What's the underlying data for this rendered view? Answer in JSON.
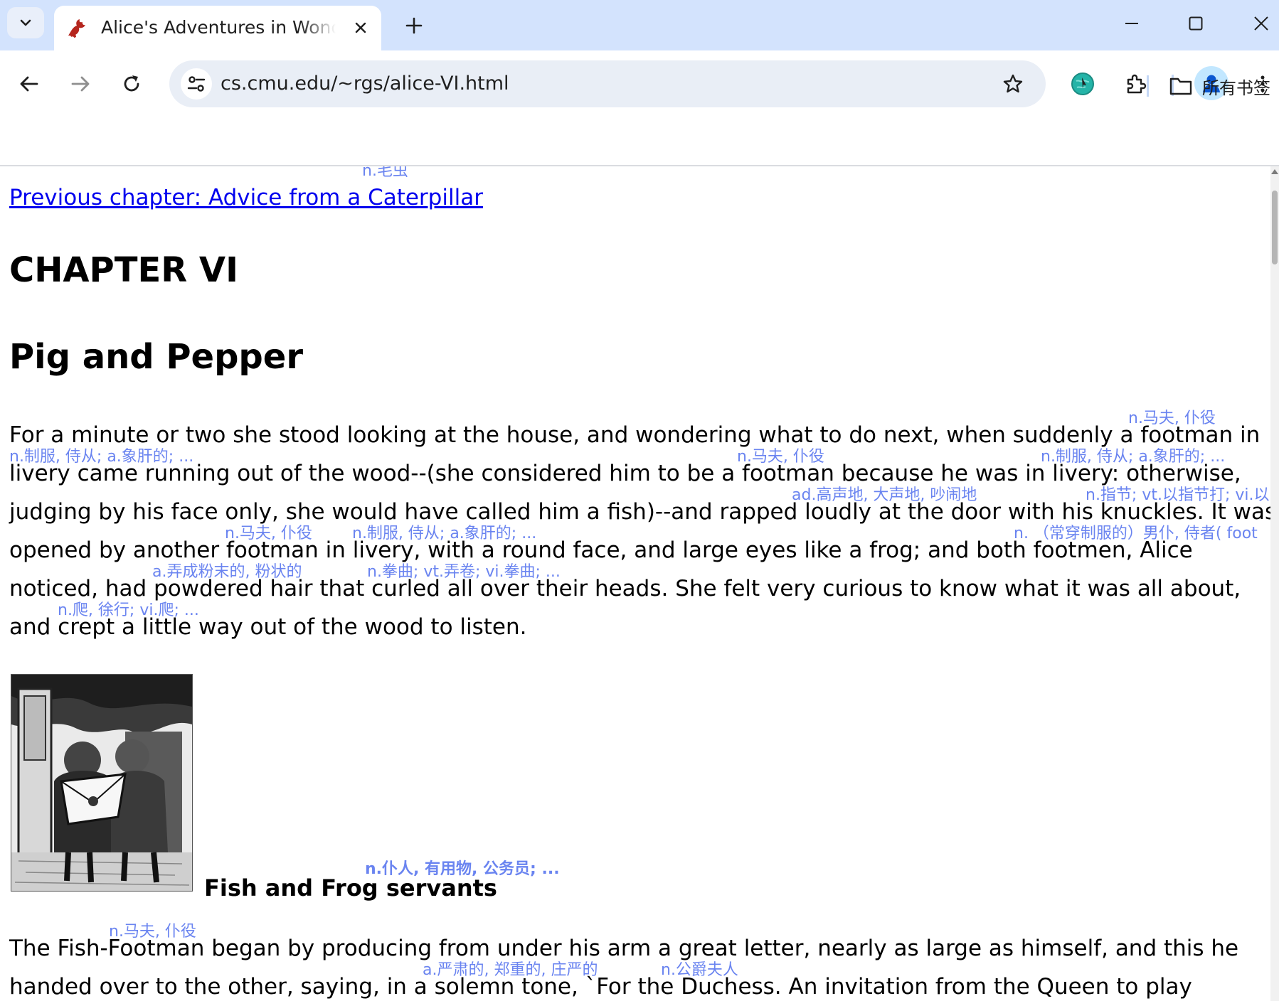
{
  "browser": {
    "tab_title": "Alice's Adventures in Wonderland",
    "url": "cs.cmu.edu/~rgs/alice-VI.html",
    "bookmarks_label": "所有书签",
    "icons": {
      "tab_dropdown": "chevron-down-icon",
      "favicon": "dragon-favicon-icon",
      "close": "close-icon",
      "new_tab": "plus-icon",
      "minimize": "minimize-icon",
      "maximize": "maximize-icon",
      "window_close": "close-icon",
      "back": "back-arrow-icon",
      "forward": "forward-arrow-icon",
      "reload": "reload-icon",
      "site_info": "tune-icon",
      "bookmark": "star-icon",
      "extension_1": "globe-extension-icon",
      "extensions": "puzzle-icon",
      "profile": "person-icon",
      "menu": "kebab-menu-icon",
      "bookmarks_folder": "folder-icon"
    },
    "colors": {
      "tab_strip": "#d3e3fd",
      "omnibox": "#e9eef6",
      "profile": "#0b57d0"
    }
  },
  "page": {
    "prev_link": "Previous chapter: Advice from a Caterpillar",
    "chapter": "CHAPTER VI",
    "title": "Pig and Pepper",
    "paragraph1_lines": [
      "For a minute or two she stood looking at the house, and wondering what to do next, when suddenly a footman in",
      "livery came running out of the wood--(she considered him to be a footman because he was in livery: otherwise,",
      "judging by his face only, she would have called him a fish)--and rapped loudly at the door with his knuckles. It was",
      "opened by another footman in livery, with a round face, and large eyes like a frog; and both footmen, Alice",
      "noticed, had powdered hair that curled all over their heads. She felt very curious to know what it was all about,",
      "and crept a little way out of the wood to listen."
    ],
    "caption": "Fish and Frog servants",
    "paragraph2_lines": [
      "The Fish-Footman began by producing from under his arm a great letter, nearly as large as himself, and this he",
      "handed over to the other, saying, in a solemn tone, `For the Duchess. An invitation from the Queen to play"
    ],
    "glosses": {
      "caterpillar": "n.毛虫",
      "footman": "n.马夫, 仆役",
      "livery": "n.制服, 侍从; a.象肝的; ...",
      "loudly": "ad.高声地, 大声地, 吵闹地",
      "knuckles": "n.指节; vt.以指节打; vi.以",
      "footmen": "n. （常穿制服的）男仆, 侍者( foot",
      "powdered": "a.弄成粉末的, 粉状的",
      "curled": "n.拳曲; vt.弄卷; vi.拳曲; ...",
      "crept": "n.爬, 徐行; vi.爬; ...",
      "servants": "n.仆人, 有用物, 公务员; ...",
      "solemn": "a.严肃的, 郑重的, 庄严的",
      "duchess": "n.公爵夫人"
    }
  }
}
